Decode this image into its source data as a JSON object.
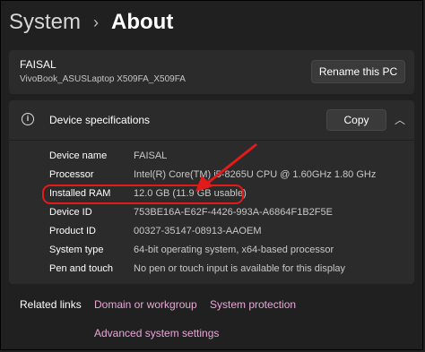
{
  "breadcrumb": {
    "root": "System",
    "separator": "›",
    "page": "About"
  },
  "device_card": {
    "device_name": "FAISAL",
    "model": "VivoBook_ASUSLaptop X509FA_X509FA",
    "rename_label": "Rename this PC"
  },
  "specs": {
    "title": "Device specifications",
    "copy_label": "Copy",
    "rows": [
      {
        "label": "Device name",
        "value": "FAISAL"
      },
      {
        "label": "Processor",
        "value": "Intel(R) Core(TM) i5-8265U CPU @ 1.60GHz   1.80 GHz"
      },
      {
        "label": "Installed RAM",
        "value": "12.0 GB (11.9 GB usable)"
      },
      {
        "label": "Device ID",
        "value": "753BE16A-E62F-4426-993A-A6864F1B2F5E"
      },
      {
        "label": "Product ID",
        "value": "00327-35147-08913-AAOEM"
      },
      {
        "label": "System type",
        "value": "64-bit operating system, x64-based processor"
      },
      {
        "label": "Pen and touch",
        "value": "No pen or touch input is available for this display"
      }
    ]
  },
  "related": {
    "label": "Related links",
    "links": [
      "Domain or workgroup",
      "System protection",
      "Advanced system settings"
    ]
  },
  "colors": {
    "background": "#202020",
    "card": "#2b2b2b",
    "annotation": "#e21a1a",
    "link": "#e8a8d6"
  }
}
